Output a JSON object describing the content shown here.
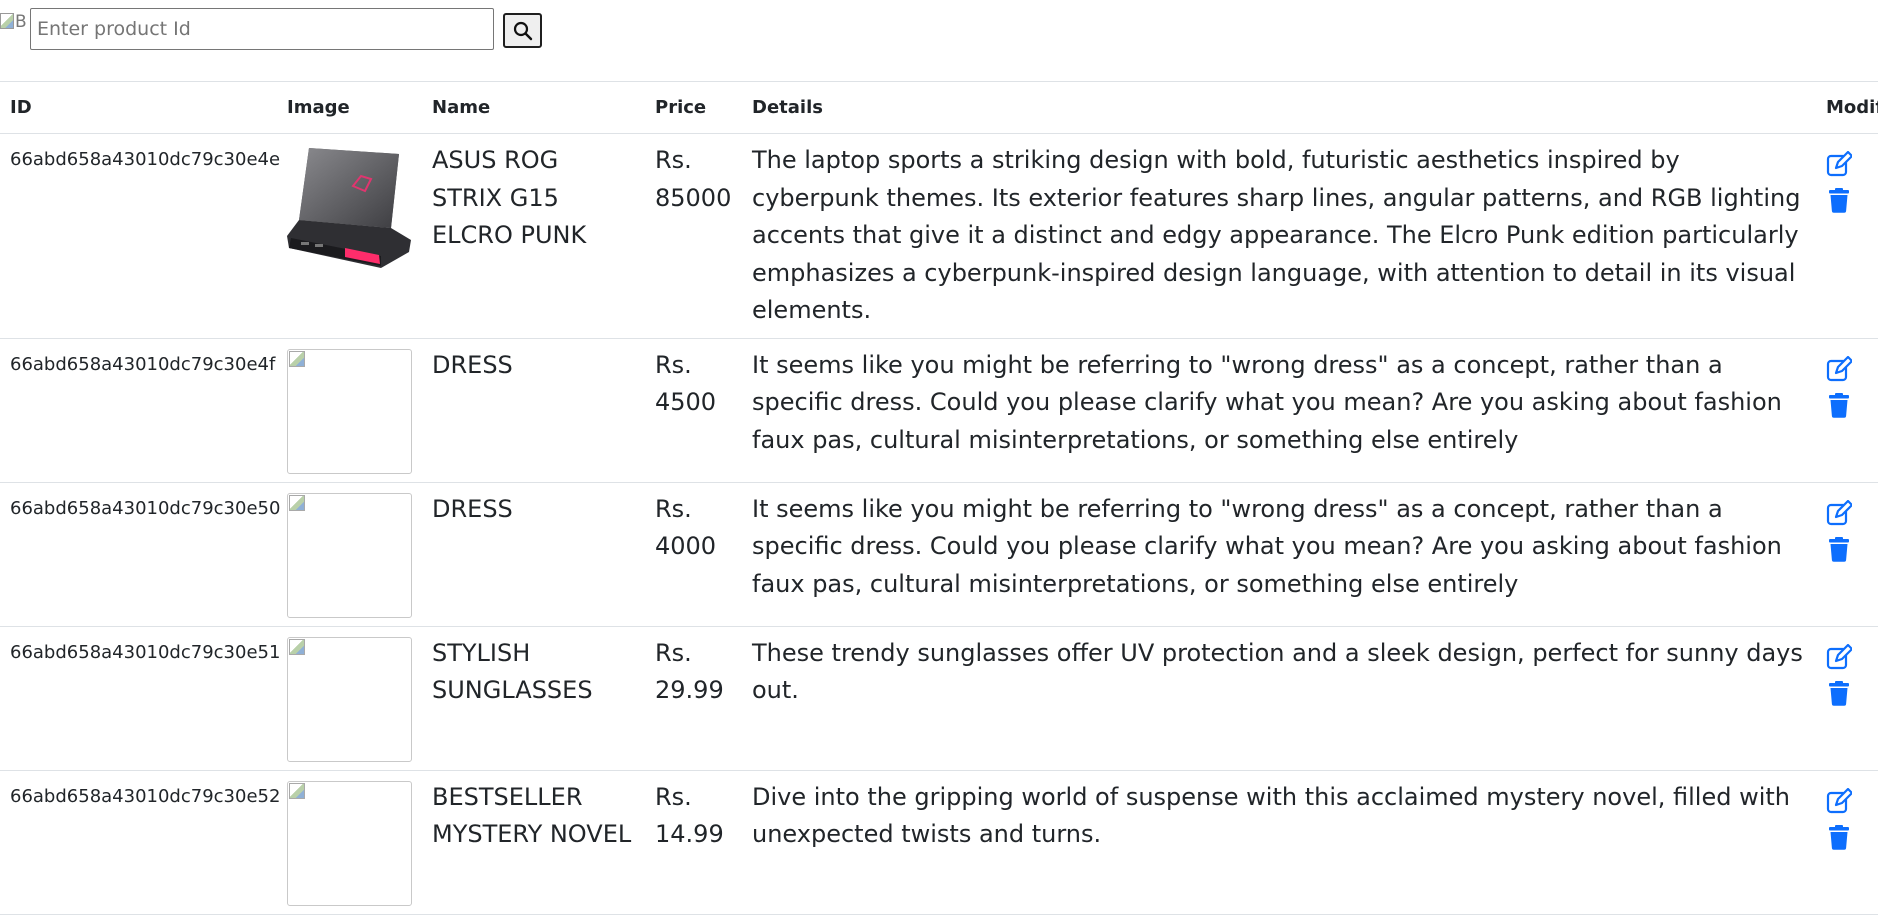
{
  "header": {
    "logo_alt": "B",
    "search": {
      "placeholder": "Enter product Id",
      "value": ""
    },
    "search_icon": "magnifier-icon"
  },
  "table": {
    "columns": [
      "ID",
      "Image",
      "Name",
      "Price",
      "Details",
      "Modify"
    ],
    "rows": [
      {
        "id": "66abd658a43010dc79c30e4e",
        "image": "laptop-photo",
        "name": "ASUS ROG STRIX G15 ELCRO PUNK",
        "price": "Rs. 85000",
        "details": "The laptop sports a striking design with bold, futuristic aesthetics inspired by cyberpunk themes. Its exterior features sharp lines, angular patterns, and RGB lighting accents that give it a distinct and edgy appearance. The Elcro Punk edition particularly emphasizes a cyberpunk-inspired design language, with attention to detail in its visual elements."
      },
      {
        "id": "66abd658a43010dc79c30e4f",
        "image": "broken-image",
        "name": "DRESS",
        "price": "Rs. 4500",
        "details": "It seems like you might be referring to \"wrong dress\" as a concept, rather than a specific dress. Could you please clarify what you mean? Are you asking about fashion faux pas, cultural misinterpretations, or something else entirely"
      },
      {
        "id": "66abd658a43010dc79c30e50",
        "image": "broken-image",
        "name": "DRESS",
        "price": "Rs. 4000",
        "details": "It seems like you might be referring to \"wrong dress\" as a concept, rather than a specific dress. Could you please clarify what you mean? Are you asking about fashion faux pas, cultural misinterpretations, or something else entirely"
      },
      {
        "id": "66abd658a43010dc79c30e51",
        "image": "broken-image",
        "name": "STYLISH SUNGLASSES",
        "price": "Rs. 29.99",
        "details": "These trendy sunglasses offer UV protection and a sleek design, perfect for sunny days out."
      },
      {
        "id": "66abd658a43010dc79c30e52",
        "image": "broken-image",
        "name": "BESTSELLER MYSTERY NOVEL",
        "price": "Rs. 14.99",
        "details": "Dive into the gripping world of suspense with this acclaimed mystery novel, filled with unexpected twists and turns."
      }
    ]
  },
  "icons": {
    "edit": "edit-icon",
    "delete": "trash-icon"
  },
  "colors": {
    "action_blue": "#0d6efd",
    "border": "#dee2e6",
    "text": "#212529"
  }
}
